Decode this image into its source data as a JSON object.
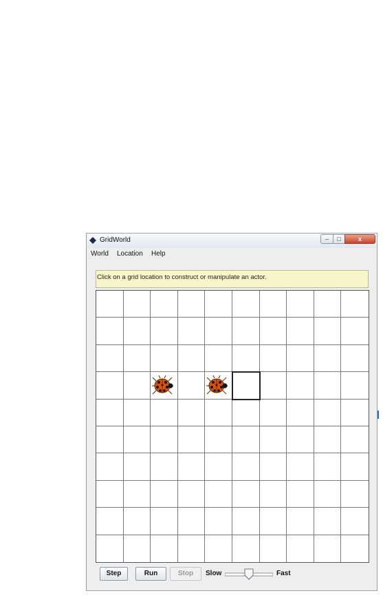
{
  "window": {
    "title": "GridWorld",
    "controls": {
      "minimize": "–",
      "maximize": "□",
      "close": "x"
    }
  },
  "menu": {
    "items": [
      "World",
      "Location",
      "Help"
    ]
  },
  "message": "Click on a grid location to construct or manipulate an actor.",
  "grid": {
    "rows": 10,
    "cols": 10,
    "actors": [
      {
        "type": "bug",
        "row": 3,
        "col": 2
      },
      {
        "type": "bug",
        "row": 3,
        "col": 4
      }
    ],
    "selected": {
      "row": 3,
      "col": 5
    },
    "colors": {
      "bug_body": "#d9520f",
      "bug_spots": "#111111",
      "selected_outline": "#222222"
    }
  },
  "controls": {
    "step_label": "Step",
    "run_label": "Run",
    "stop_label": "Stop",
    "slow_label": "Slow",
    "fast_label": "Fast",
    "speed": 0.5
  },
  "icons": [
    "window-app-icon",
    "minimize-icon",
    "maximize-icon",
    "close-icon",
    "bug-icon",
    "slider-thumb-icon"
  ]
}
